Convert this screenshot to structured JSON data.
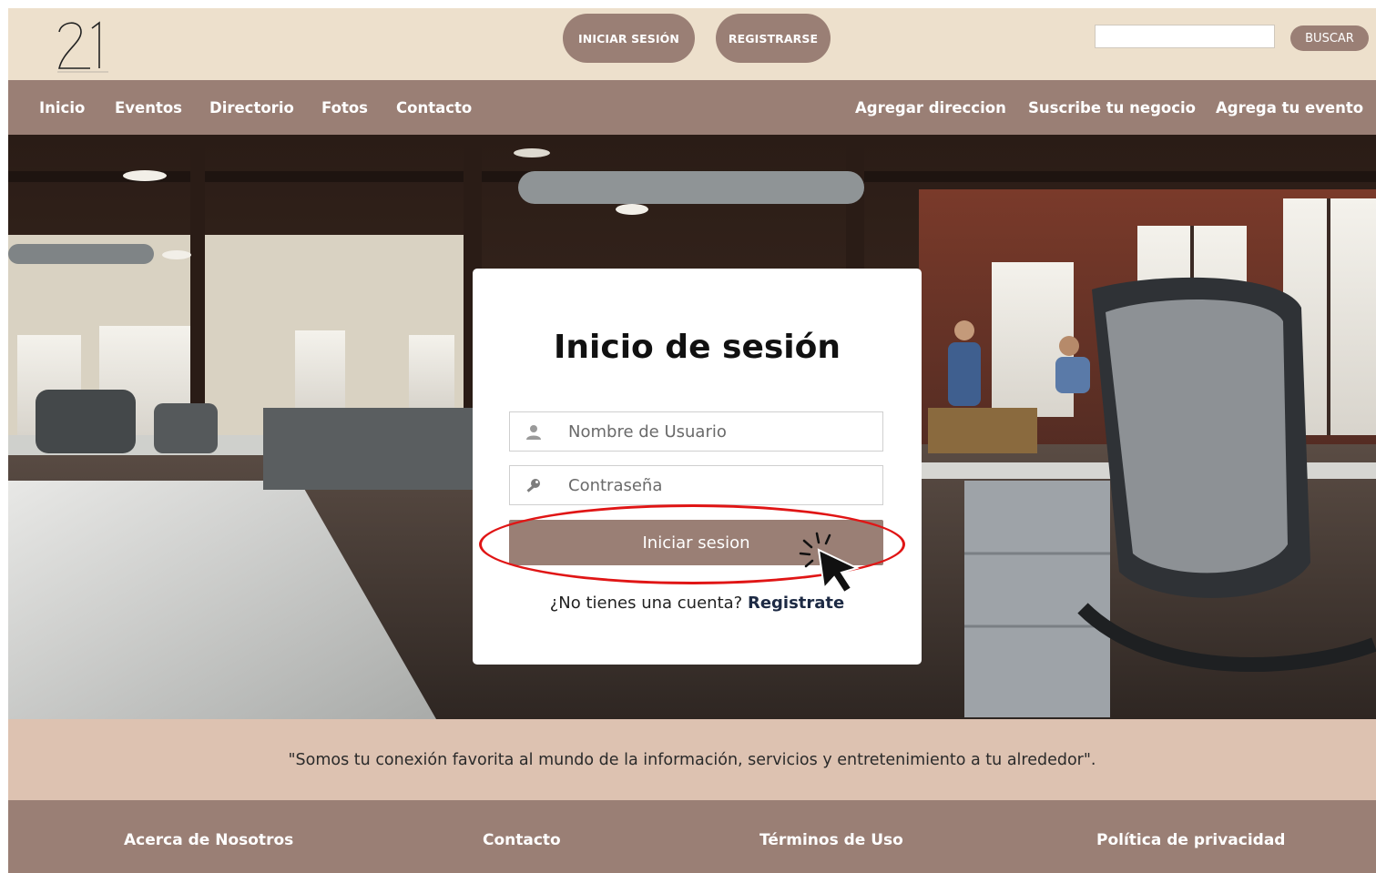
{
  "header": {
    "logo_text": "21",
    "login_label": "INICIAR SESIÓN",
    "register_label": "REGISTRARSE",
    "search": {
      "value": "",
      "placeholder": "",
      "button_label": "BUSCAR"
    }
  },
  "nav": {
    "left": [
      "Inicio",
      "Eventos",
      "Directorio",
      "Fotos",
      "Contacto"
    ],
    "right": [
      "Agregar direccion",
      "Suscribe tu negocio",
      "Agrega tu evento"
    ]
  },
  "login": {
    "title": "Inicio de sesión",
    "username_placeholder": "Nombre de Usuario",
    "password_placeholder": "Contraseña",
    "submit_label": "Iniciar sesion",
    "no_account_text": "¿No tienes una cuenta?",
    "register_link": "Registrate"
  },
  "tagline": "\"Somos tu conexión favorita al mundo de la información, servicios y entretenimiento a tu alrededor\".",
  "footer": [
    "Acerca de Nosotros",
    "Contacto",
    "Términos de Uso",
    "Política de privacidad"
  ],
  "colors": {
    "topbar": "#ede0cc",
    "accent": "#9a7f75",
    "tagline_bg": "#ddc2b1",
    "highlight": "#e01515"
  },
  "icons": [
    "user-icon",
    "key-icon",
    "cursor-click-icon"
  ]
}
